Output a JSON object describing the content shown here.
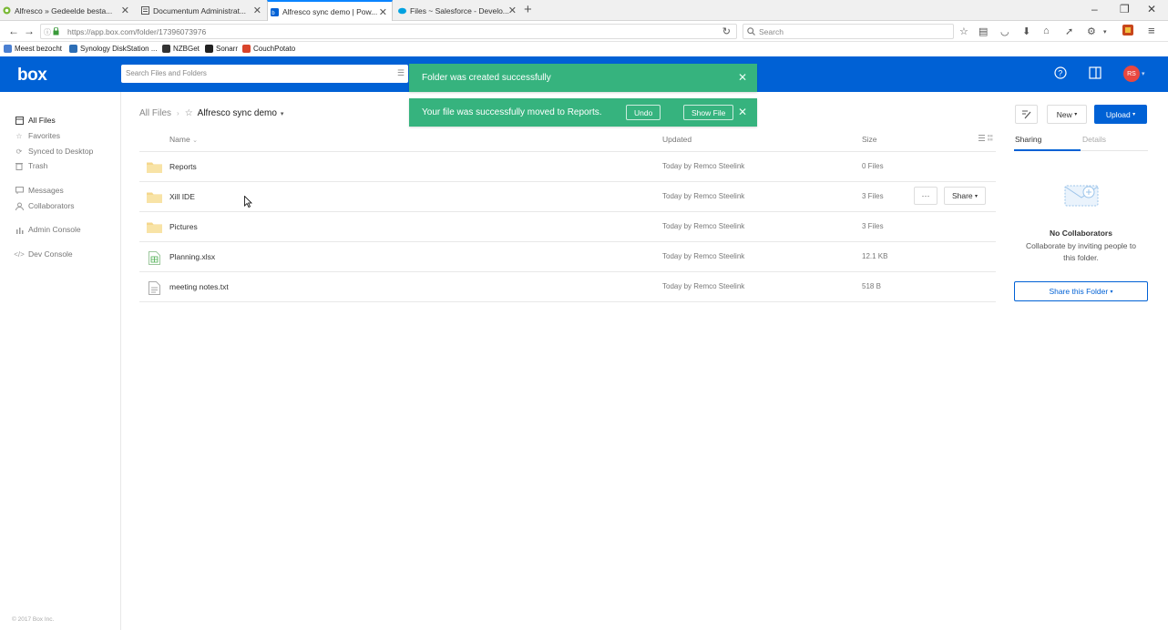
{
  "browser": {
    "tabs": [
      {
        "title": "Alfresco » Gedeelde besta...",
        "active": false
      },
      {
        "title": "Documentum Administrat...",
        "active": false
      },
      {
        "title": "Alfresco sync demo | Pow...",
        "active": true
      },
      {
        "title": "Files ~ Salesforce - Develo...",
        "active": false
      }
    ],
    "url": "https://app.box.com/folder/17396073976",
    "search_placeholder": "Search",
    "bookmarks": [
      "Meest bezocht",
      "Synology DiskStation ...",
      "NZBGet",
      "Sonarr",
      "CouchPotato"
    ]
  },
  "header": {
    "logo": "box",
    "search_placeholder": "Search Files and Folders",
    "avatar_initials": "RS"
  },
  "toasts": {
    "folder_created": "Folder was created successfully",
    "file_moved": "Your file was successfully moved to Reports.",
    "undo_label": "Undo",
    "show_file_label": "Show File"
  },
  "sidebar": {
    "items": [
      {
        "label": "All Files",
        "icon": "files-icon"
      },
      {
        "label": "Favorites",
        "icon": "star-icon"
      },
      {
        "label": "Synced to Desktop",
        "icon": "sync-icon"
      },
      {
        "label": "Trash",
        "icon": "trash-icon"
      },
      {
        "label": "Messages",
        "icon": "messages-icon"
      },
      {
        "label": "Collaborators",
        "icon": "collaborators-icon"
      },
      {
        "label": "Admin Console",
        "icon": "chart-icon"
      },
      {
        "label": "Dev Console",
        "icon": "code-icon"
      }
    ],
    "copyright": "© 2017 Box Inc."
  },
  "breadcrumb": {
    "root": "All Files",
    "current": "Alfresco sync demo"
  },
  "table": {
    "columns": {
      "name": "Name",
      "updated": "Updated",
      "size": "Size"
    },
    "rows": [
      {
        "name": "Reports",
        "type": "folder",
        "updated": "Today by Remco Steelink",
        "size": "0 Files"
      },
      {
        "name": "Xill IDE",
        "type": "folder",
        "updated": "Today by Remco Steelink",
        "size": "3 Files"
      },
      {
        "name": "Pictures",
        "type": "folder",
        "updated": "Today by Remco Steelink",
        "size": "3 Files"
      },
      {
        "name": "Planning.xlsx",
        "type": "excel",
        "updated": "Today by Remco Steelink",
        "size": "12.1 KB"
      },
      {
        "name": "meeting notes.txt",
        "type": "text",
        "updated": "Today by Remco Steelink",
        "size": "518 B"
      }
    ],
    "share_label": "Share",
    "more_label": "···"
  },
  "toolbar": {
    "new_label": "New",
    "upload_label": "Upload"
  },
  "panel": {
    "tab_sharing": "Sharing",
    "tab_details": "Details",
    "no_collab_title": "No Collaborators",
    "no_collab_text": "Collaborate by inviting people to this folder.",
    "share_folder_label": "Share this Folder"
  },
  "colors": {
    "brand": "#0061d5",
    "toast": "#36b37e",
    "avatar": "#e9473f"
  }
}
